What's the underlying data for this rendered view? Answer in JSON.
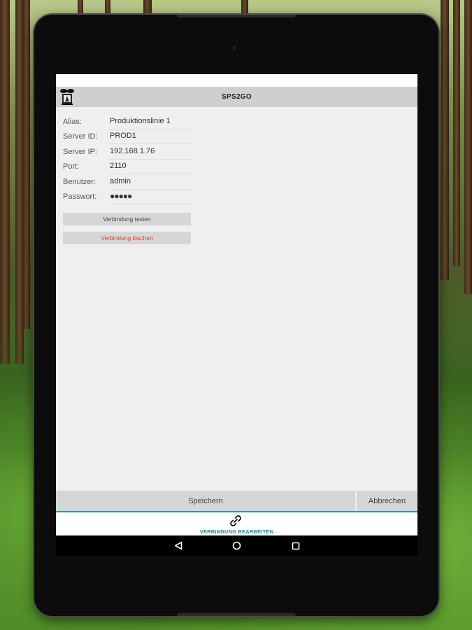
{
  "app": {
    "title": "SPS2GO"
  },
  "form": {
    "fields": [
      {
        "label": "Alias:",
        "value": "Produktionslinie 1"
      },
      {
        "label": "Server ID:",
        "value": "PROD1"
      },
      {
        "label": "Server IP:",
        "value": "192.168.1.76"
      },
      {
        "label": "Port:",
        "value": "2110"
      },
      {
        "label": "Benutzer:",
        "value": "admin"
      },
      {
        "label": "Passwort:",
        "value": "●●●●●"
      }
    ],
    "test_button": "Verbindung testen",
    "delete_button": "Verbindung löschen"
  },
  "actions": {
    "save": "Speichern",
    "cancel": "Abbrechen"
  },
  "tab": {
    "label": "VERBINDUNG BEARBEITEN",
    "icon": "link-icon",
    "accent": "#1e9e9a"
  },
  "nav": {
    "back_icon": "back-triangle-icon",
    "home_icon": "home-circle-icon",
    "recents_icon": "recents-square-icon"
  },
  "colors": {
    "delete_text": "#e0433b",
    "app_bar": "#cfcfcf"
  }
}
